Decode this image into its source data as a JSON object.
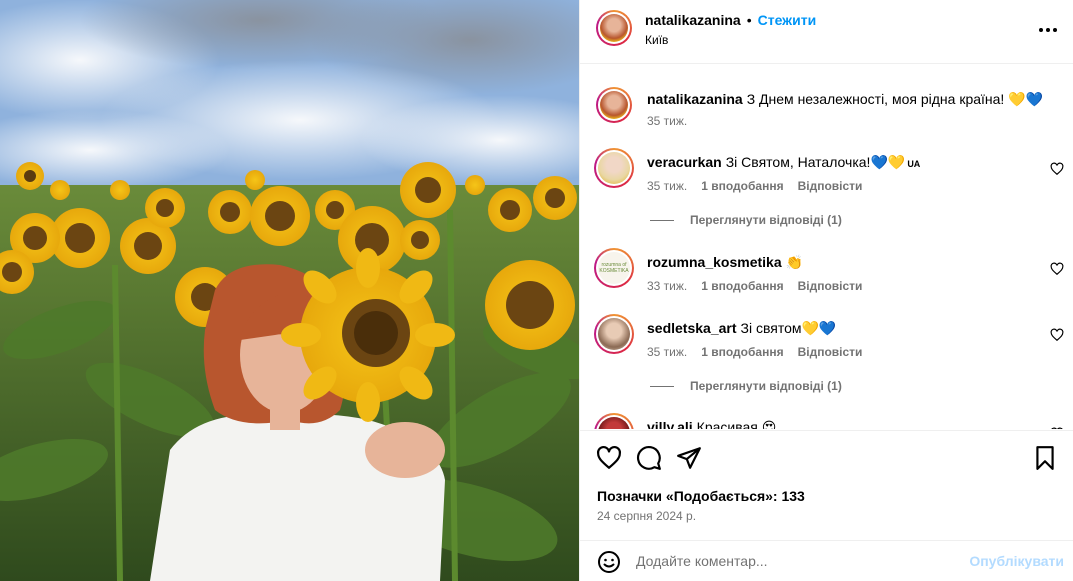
{
  "post": {
    "username": "natalikazanina",
    "follow_label": "Стежити",
    "location": "Київ",
    "caption": {
      "username": "natalikazanina",
      "text": "З Днем незалежності, моя рідна країна!",
      "emoji": "💛💙",
      "time": "35 тиж."
    }
  },
  "comments": [
    {
      "username": "veracurkan",
      "text": "Зі Святом, Наталочка!",
      "emoji": "💙💛",
      "flag": "UA",
      "time": "35 тиж.",
      "likes": "1 вподобання",
      "reply": "Відповісти",
      "view_replies": "Переглянути відповіді (1)"
    },
    {
      "username": "rozumna_kosmetika",
      "text": "",
      "emoji": "👏",
      "time": "33 тиж.",
      "likes": "1 вподобання",
      "reply": "Відповісти",
      "avatar_text": "rozumna of KOSMETIKA"
    },
    {
      "username": "sedletska_art",
      "text": "Зі святом",
      "emoji": "💛💙",
      "time": "35 тиж.",
      "likes": "1 вподобання",
      "reply": "Відповісти",
      "view_replies": "Переглянути відповіді (1)"
    },
    {
      "username": "villy.ali",
      "text": "Красивая",
      "emoji": "😍"
    }
  ],
  "likes_label": "Позначки «Подобається»: 133",
  "date": "24 серпня 2024 р.",
  "add_comment": {
    "placeholder": "Додайте коментар...",
    "publish": "Опублікувати"
  },
  "colors": {
    "follow": "#0095f6",
    "muted": "#737373",
    "publish_disabled": "#b3dbff"
  },
  "icons": [
    "more-icon",
    "heart-icon",
    "comment-icon",
    "share-icon",
    "bookmark-icon",
    "emoji-icon"
  ]
}
